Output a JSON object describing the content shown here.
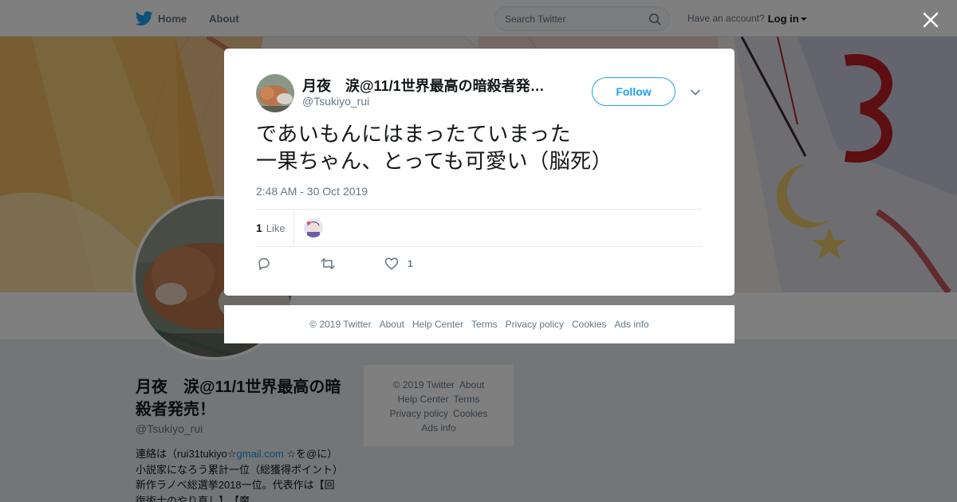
{
  "nav": {
    "home": "Home",
    "about": "About",
    "search_placeholder": "Search Twitter",
    "account_prompt": "Have an account?",
    "login": "Log in"
  },
  "profile": {
    "name": "月夜　涙@11/1世界最高の暗殺者発売！",
    "handle": "@Tsukiyo_rui",
    "bio_prefix": "連絡は（rui31tukiyo☆",
    "bio_link": "gmail.com",
    "bio_suffix": " ☆を@に）小説家になろう累計一位（総獲得ポイント）　新作ラノベ総選挙2018一位。代表作は【回復術士のやり直し】、【魔"
  },
  "side_footer": {
    "copyright": "© 2019 Twitter",
    "about": "About",
    "help": "Help Center",
    "terms": "Terms",
    "privacy": "Privacy policy",
    "cookies": "Cookies",
    "ads": "Ads info"
  },
  "tweet": {
    "author_name": "月夜　涙@11/1世界最高の暗殺者発…",
    "author_handle": "@Tsukiyo_rui",
    "follow_label": "Follow",
    "text": "であいもんにはまったていまった\n一果ちゃん、とっても可愛い（脳死）",
    "timestamp": "2:48 AM - 30 Oct 2019",
    "like_count": "1",
    "like_label": "Like",
    "action_like_count": "1"
  },
  "modal_footer": {
    "copyright": "© 2019 Twitter",
    "about": "About",
    "help": "Help Center",
    "terms": "Terms",
    "privacy": "Privacy policy",
    "cookies": "Cookies",
    "ads": "Ads info"
  },
  "icons": {
    "brand": "twitter-bird-icon",
    "search": "search-icon",
    "close": "close-icon",
    "reply": "reply-icon",
    "retweet": "retweet-icon",
    "like": "heart-icon",
    "more": "chevron-down-icon"
  },
  "colors": {
    "brand_blue": "#1da1f2",
    "link_blue": "#1b95e0",
    "secondary_text": "#657786",
    "overlay": "rgba(0,0,0,0.5)"
  }
}
